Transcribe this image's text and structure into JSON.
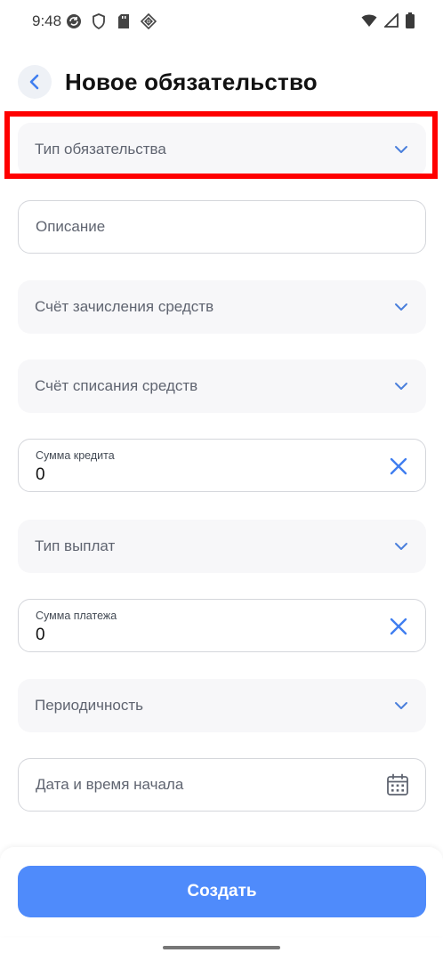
{
  "status_bar": {
    "time": "9:48",
    "left_icons": [
      "sync-icon",
      "shield-icon",
      "sd-card-icon",
      "diamond-icon"
    ],
    "right_icons": [
      "wifi-icon",
      "signal-icon",
      "battery-icon"
    ]
  },
  "header": {
    "title": "Новое обязательство",
    "back_icon": "chevron-left-icon"
  },
  "form": {
    "obligation_type": {
      "label": "Тип обязательства"
    },
    "description": {
      "placeholder": "Описание"
    },
    "credit_account": {
      "label": "Счёт зачисления средств"
    },
    "debit_account": {
      "label": "Счёт списания средств"
    },
    "credit_amount": {
      "label": "Сумма кредита",
      "value": "0"
    },
    "payment_type": {
      "label": "Тип выплат"
    },
    "payment_amount": {
      "label": "Сумма платежа",
      "value": "0"
    },
    "periodicity": {
      "label": "Периодичность"
    },
    "start_datetime": {
      "placeholder": "Дата и время начала"
    }
  },
  "actions": {
    "create_label": "Создать"
  },
  "colors": {
    "accent": "#4f8bfb",
    "highlight": "#ff0000",
    "select_bg": "#f7f7f9",
    "border": "#d4d6db"
  }
}
